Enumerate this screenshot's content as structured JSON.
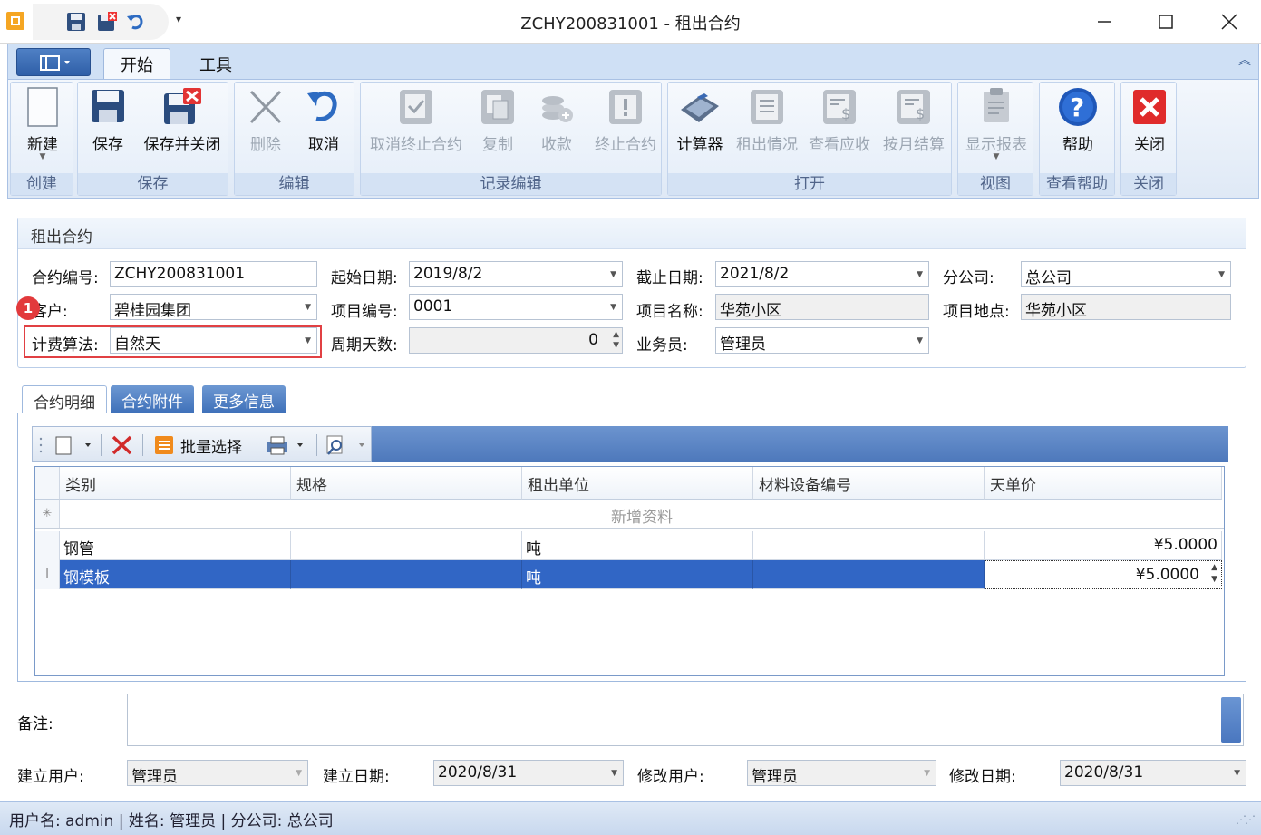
{
  "window": {
    "title": "ZCHY200831001 - 租出合约"
  },
  "ribbon": {
    "tabs": [
      "开始",
      "工具"
    ],
    "groups": {
      "create": {
        "label": "创建",
        "new": "新建"
      },
      "save": {
        "label": "保存",
        "save": "保存",
        "save_close": "保存并关闭"
      },
      "edit": {
        "label": "编辑",
        "delete": "删除",
        "cancel": "取消"
      },
      "record": {
        "label": "记录编辑",
        "cancel_terminate": "取消终止合约",
        "copy": "复制",
        "collect": "收款",
        "terminate": "终止合约"
      },
      "open": {
        "label": "打开",
        "calculator": "计算器",
        "rental_status": "租出情况",
        "view_receivable": "查看应收",
        "monthly_settle": "按月结算"
      },
      "view": {
        "label": "视图",
        "show_report": "显示报表"
      },
      "help": {
        "label": "查看帮助",
        "help": "帮助"
      },
      "close": {
        "label": "关闭",
        "close": "关闭"
      }
    }
  },
  "form": {
    "title": "租出合约",
    "contract_no": {
      "label": "合约编号:",
      "value": "ZCHY200831001"
    },
    "start_date": {
      "label": "起始日期:",
      "value": "2019/8/2"
    },
    "end_date": {
      "label": "截止日期:",
      "value": "2021/8/2"
    },
    "branch": {
      "label": "分公司:",
      "value": "总公司"
    },
    "customer": {
      "label": "客户:",
      "value": "碧桂园集团"
    },
    "project_no": {
      "label": "项目编号:",
      "value": "0001"
    },
    "project_name": {
      "label": "项目名称:",
      "value": "华苑小区"
    },
    "project_location": {
      "label": "项目地点:",
      "value": "华苑小区"
    },
    "billing_method": {
      "label": "计费算法:",
      "value": "自然天"
    },
    "cycle_days": {
      "label": "周期天数:",
      "value": "0"
    },
    "salesperson": {
      "label": "业务员:",
      "value": "管理员"
    },
    "marker": "1"
  },
  "detail_tabs": [
    "合约明细",
    "合约附件",
    "更多信息"
  ],
  "grid_toolbar": {
    "batch_select": "批量选择"
  },
  "grid": {
    "columns": [
      "类别",
      "规格",
      "租出单位",
      "材料设备编号",
      "天单价"
    ],
    "new_row_text": "新增资料",
    "rows": [
      {
        "category": "钢管",
        "spec": "",
        "unit": "吨",
        "code": "",
        "price": "¥5.0000"
      },
      {
        "category": "钢模板",
        "spec": "",
        "unit": "吨",
        "code": "",
        "price": "¥5.0000"
      }
    ]
  },
  "remarks": {
    "label": "备注:",
    "value": ""
  },
  "footer": {
    "created_by": {
      "label": "建立用户:",
      "value": "管理员"
    },
    "created_date": {
      "label": "建立日期:",
      "value": "2020/8/31"
    },
    "modified_by": {
      "label": "修改用户:",
      "value": "管理员"
    },
    "modified_date": {
      "label": "修改日期:",
      "value": "2020/8/31"
    }
  },
  "status": {
    "text": "用户名: admin | 姓名: 管理员  | 分公司: 总公司"
  }
}
